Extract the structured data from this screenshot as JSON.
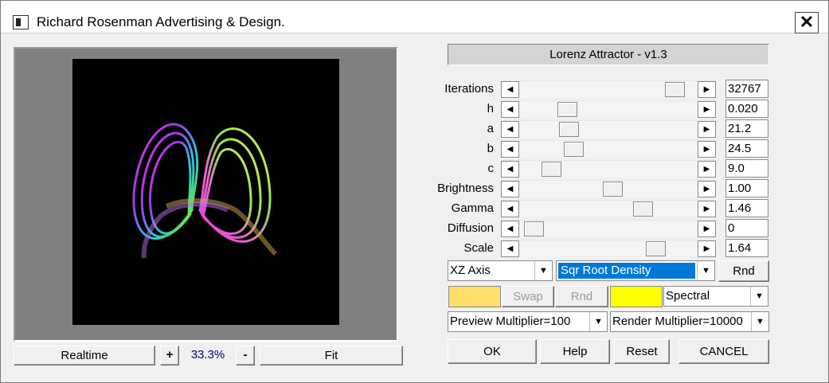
{
  "window": {
    "title": "Richard Rosenman Advertising & Design.",
    "close_glyph": "✕"
  },
  "filter_name": "Lorenz Attractor - v1.3",
  "params": [
    {
      "label": "Iterations",
      "value": "32767",
      "level": 0.92
    },
    {
      "label": "h",
      "value": "0.020",
      "level": 0.24
    },
    {
      "label": "a",
      "value": "21.2",
      "level": 0.25
    },
    {
      "label": "b",
      "value": "24.5",
      "level": 0.28
    },
    {
      "label": "c",
      "value": "9.0",
      "level": 0.14
    },
    {
      "label": "Brightness",
      "value": "1.00",
      "level": 0.53
    },
    {
      "label": "Gamma",
      "value": "1.46",
      "level": 0.72
    },
    {
      "label": "Diffusion",
      "value": "0",
      "level": 0.03
    },
    {
      "label": "Scale",
      "value": "1.64",
      "level": 0.8
    }
  ],
  "arrows": {
    "left": "◀",
    "right": "▶",
    "down": "▼"
  },
  "axis_select": "XZ Axis",
  "density_select": "Sqr Root Density",
  "rnd_label": "Rnd",
  "colors": {
    "swatch_1": "#ffdf6b",
    "swatch_2": "#ffff00",
    "swap_label": "Swap",
    "rnd_label": "Rnd",
    "palette_select": "Spectral"
  },
  "preview_multiplier": "Preview Multiplier=100",
  "render_multiplier": "Render  Multiplier=10000",
  "buttons": {
    "ok": "OK",
    "help": "Help",
    "reset": "Reset",
    "cancel": "CANCEL"
  },
  "preview_bar": {
    "realtime": "Realtime",
    "plus": "+",
    "zoom": "33.3%",
    "minus": "-",
    "fit": "Fit"
  }
}
